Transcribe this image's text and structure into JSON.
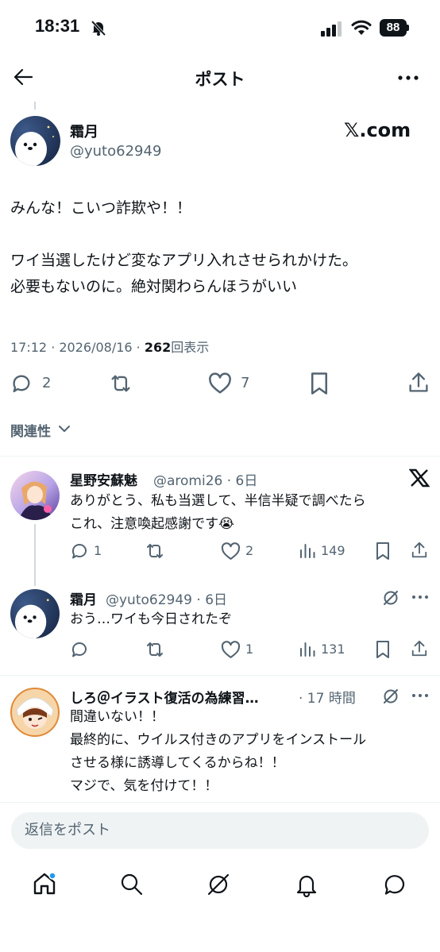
{
  "status_bar": {
    "time": "18:31",
    "battery": "88"
  },
  "header": {
    "title": "ポスト"
  },
  "post": {
    "author_name": "霜月",
    "author_handle": "@yuto62949",
    "source_label": "𝕏.com",
    "text": "みんな！こいつ詐欺や！！\n\nワイ当選したけど変なアプリ入れさせられかけた。\n必要もないのに。絶対関わらんほうがいい",
    "time": "17:12 · 2026/08/16 · ",
    "views_count": "262",
    "views_label": "回表示",
    "replies": "2",
    "reposts": "",
    "likes": "7"
  },
  "sort": {
    "label": "関連性"
  },
  "replies": [
    {
      "name": "星野安蘇魅",
      "handle": "@aromi26 · 6日",
      "text": "ありがとう、私も当選して、半信半疑で調べたら\nこれ、注意喚起感謝です😭",
      "reply_count": "1",
      "like_count": "2",
      "view_count": "149"
    },
    {
      "name": "霜月",
      "handle": "@yuto62949 · 6日",
      "text": "おう…ワイも今日されたぞ",
      "reply_count": "",
      "like_count": "1",
      "view_count": "131"
    },
    {
      "name": "しろ＠イラスト復活の為練習…",
      "handle": "· 17 時間",
      "text": "間違いない！！\n最終的に、ウイルス付きのアプリをインストール\nさせる様に誘導してくるからね！！\nマジで、気を付けて！！"
    }
  ],
  "composer": {
    "placeholder": "返信をポスト"
  },
  "colors": {
    "text": "#0f1419",
    "secondary": "#536471",
    "accent": "#1d9bf0",
    "divider": "#eff3f4"
  }
}
